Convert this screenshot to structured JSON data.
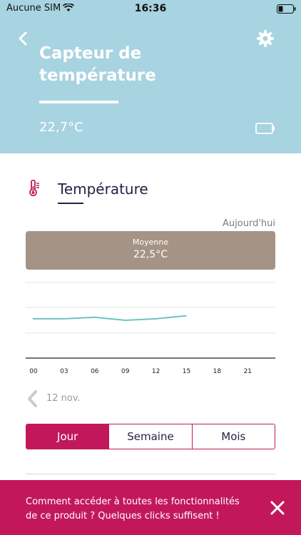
{
  "status_bar": {
    "carrier": "Aucune SIM",
    "time": "16:36"
  },
  "header": {
    "title": "Capteur de température",
    "temperature": "22,7°C"
  },
  "section": {
    "title": "Température"
  },
  "summary": {
    "period": "Aujourd'hui",
    "average_label": "Moyenne",
    "average_value": "22,5°C"
  },
  "chart_data": {
    "type": "line",
    "x": [
      "00",
      "03",
      "06",
      "09",
      "12",
      "15",
      "18",
      "21"
    ],
    "series": [
      {
        "values": [
          22.6,
          22.6,
          22.7,
          22.5,
          22.6,
          22.8
        ],
        "color": "#6cc4c0"
      }
    ],
    "grid": true
  },
  "navigation": {
    "previous_date": "12 nov."
  },
  "segments": [
    {
      "label": "Jour",
      "active": true
    },
    {
      "label": "Semaine",
      "active": false
    },
    {
      "label": "Mois",
      "active": false
    }
  ],
  "banner": {
    "text": "Comment accéder à toutes les fonctionnalités de ce produit ? Quelques clicks suffisent !"
  },
  "colors": {
    "header": "#a8d3e0",
    "accent": "#c2185b",
    "average_box": "#a59385",
    "line": "#6cc4c0"
  },
  "icons": [
    "wifi-icon",
    "battery-icon",
    "back-chevron-icon",
    "gear-icon",
    "device-battery-icon",
    "thermometer-icon",
    "chevron-left-icon",
    "close-icon"
  ]
}
